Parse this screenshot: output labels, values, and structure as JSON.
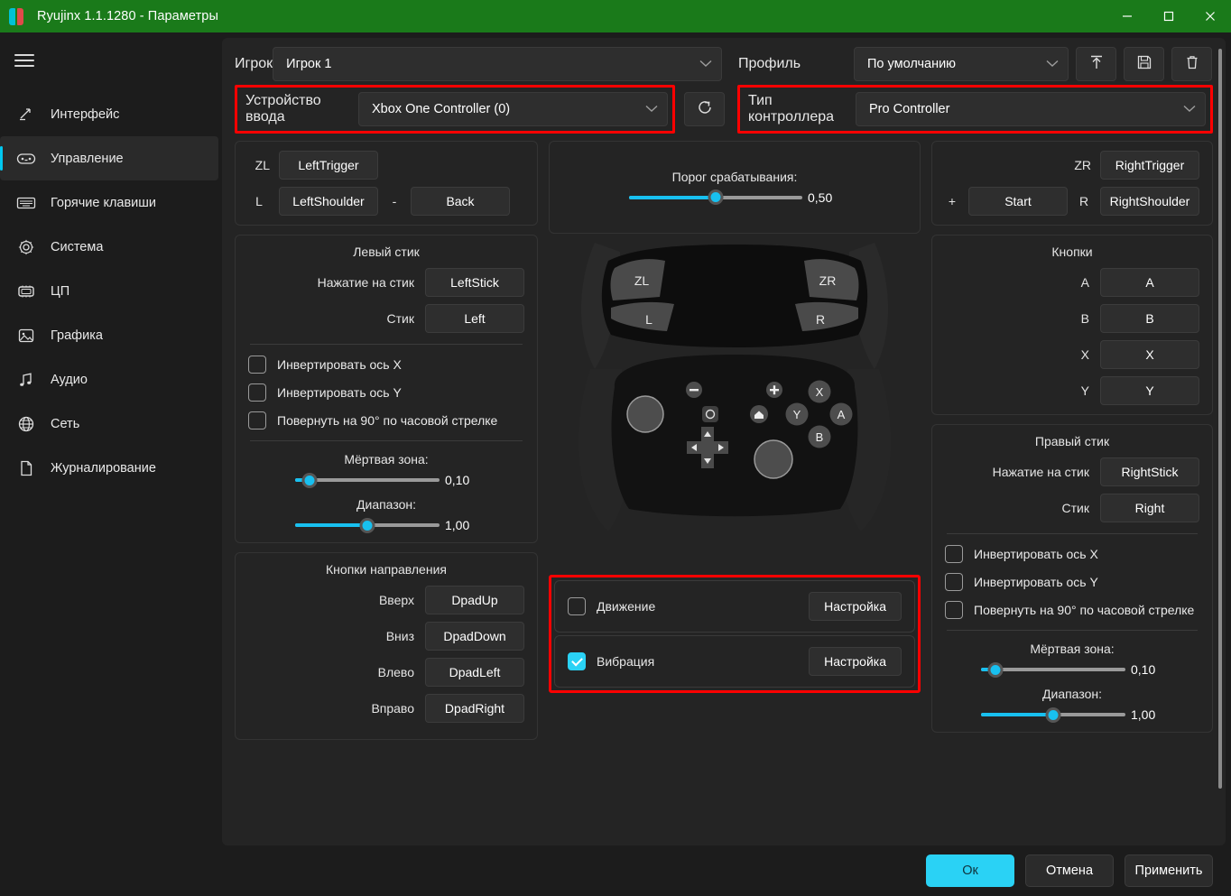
{
  "window": {
    "title": "Ryujinx 1.1.1280 - Параметры",
    "minimize_label": "minimize",
    "maximize_label": "maximize",
    "close_label": "close"
  },
  "sidebar": {
    "menu_label": "menu",
    "items": [
      {
        "label": "Интерфейс",
        "icon": "interface-icon",
        "active": false
      },
      {
        "label": "Управление",
        "icon": "gamepad-icon",
        "active": true
      },
      {
        "label": "Горячие клавиши",
        "icon": "keyboard-icon",
        "active": false
      },
      {
        "label": "Система",
        "icon": "gear-icon",
        "active": false
      },
      {
        "label": "ЦП",
        "icon": "cpu-icon",
        "active": false
      },
      {
        "label": "Графика",
        "icon": "image-icon",
        "active": false
      },
      {
        "label": "Аудио",
        "icon": "music-note-icon",
        "active": false
      },
      {
        "label": "Сеть",
        "icon": "globe-icon",
        "active": false
      },
      {
        "label": "Журналирование",
        "icon": "document-icon",
        "active": false
      }
    ]
  },
  "top": {
    "player_label": "Игрок",
    "player_value": "Игрок 1",
    "profile_label": "Профиль",
    "profile_value": "По умолчанию",
    "load_icon": "upload-arrow-icon",
    "save_icon": "floppy-disk-icon",
    "delete_icon": "trash-icon",
    "input_device_label": "Устройство ввода",
    "input_device_value": "Xbox One Controller (0)",
    "refresh_icon": "refresh-icon",
    "controller_type_label": "Тип контроллера",
    "controller_type_value": "Pro Controller"
  },
  "left_triggers": {
    "zl_label": "ZL",
    "zl_value": "LeftTrigger",
    "l_label": "L",
    "l_value": "LeftShoulder",
    "minus_label": "-",
    "minus_value": "Back"
  },
  "trigger_threshold": {
    "title": "Порог срабатывания:",
    "value": "0,50",
    "percent": 50
  },
  "right_triggers": {
    "zr_label": "ZR",
    "zr_value": "RightTrigger",
    "plus_label": "+",
    "plus_value": "Start",
    "r_label": "R",
    "r_value": "RightShoulder"
  },
  "left_stick": {
    "title": "Левый стик",
    "press_label": "Нажатие на стик",
    "press_value": "LeftStick",
    "stick_label": "Стик",
    "stick_value": "Left",
    "invert_x_label": "Инвертировать ось X",
    "invert_x_checked": false,
    "invert_y_label": "Инвертировать ось Y",
    "invert_y_checked": false,
    "rotate_label": "Повернуть на 90° по часовой стрелке",
    "rotate_checked": false,
    "deadzone_label": "Мёртвая зона:",
    "deadzone_value": "0,10",
    "deadzone_percent": 10,
    "range_label": "Диапазон:",
    "range_value": "1,00",
    "range_percent": 50
  },
  "dpad": {
    "title": "Кнопки направления",
    "rows": [
      {
        "label": "Вверх",
        "value": "DpadUp"
      },
      {
        "label": "Вниз",
        "value": "DpadDown"
      },
      {
        "label": "Влево",
        "value": "DpadLeft"
      },
      {
        "label": "Вправо",
        "value": "DpadRight"
      }
    ]
  },
  "buttons_panel": {
    "title": "Кнопки",
    "rows": [
      {
        "label": "A",
        "value": "A"
      },
      {
        "label": "B",
        "value": "B"
      },
      {
        "label": "X",
        "value": "X"
      },
      {
        "label": "Y",
        "value": "Y"
      }
    ]
  },
  "right_stick": {
    "title": "Правый стик",
    "press_label": "Нажатие на стик",
    "press_value": "RightStick",
    "stick_label": "Стик",
    "stick_value": "Right",
    "invert_x_label": "Инвертировать ось X",
    "invert_x_checked": false,
    "invert_y_label": "Инвертировать ось Y",
    "invert_y_checked": false,
    "rotate_label": "Повернуть на 90° по часовой стрелке",
    "rotate_checked": false,
    "deadzone_label": "Мёртвая зона:",
    "deadzone_value": "0,10",
    "deadzone_percent": 10,
    "range_label": "Диапазон:",
    "range_value": "1,00",
    "range_percent": 50
  },
  "motion": {
    "label": "Движение",
    "checked": false,
    "config_label": "Настройка"
  },
  "vibration": {
    "label": "Вибрация",
    "checked": true,
    "config_label": "Настройка"
  },
  "controller_art": {
    "zl": "ZL",
    "zr": "ZR",
    "l": "L",
    "r": "R",
    "x": "X",
    "y": "Y",
    "a": "A",
    "b": "B"
  },
  "footer": {
    "ok_label": "Ок",
    "cancel_label": "Отмена",
    "apply_label": "Применить"
  },
  "colors": {
    "titlebar": "#1a7a1a",
    "accent": "#2ad2f5",
    "slider_fill": "#18c0f0",
    "highlight": "#ff0000",
    "panel": "#242424",
    "background": "#1c1c1c"
  }
}
